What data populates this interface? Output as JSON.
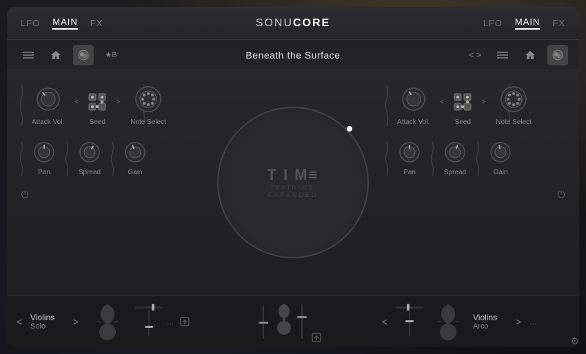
{
  "nav": {
    "left": {
      "tabs": [
        "LFO",
        "MAIN",
        "FX"
      ]
    },
    "right": {
      "tabs": [
        "LFO",
        "MAIN",
        "FX"
      ]
    },
    "logo": "SONU CORE",
    "active_tab": "MAIN"
  },
  "toolbar": {
    "title": "Beneath the Surface",
    "left_buttons": [
      "menu",
      "home",
      "layers"
    ],
    "right_buttons": [
      "menu",
      "home",
      "layers"
    ],
    "bookmark": "★B",
    "arrows": "< >"
  },
  "left_panel": {
    "row1": {
      "attack_vol": {
        "label": "Attack Vol."
      },
      "seed": {
        "label": "Seed"
      },
      "note_select": {
        "label": "Note Select"
      }
    },
    "row2": {
      "pan": {
        "label": "Pan"
      },
      "spread": {
        "label": "Spread"
      },
      "gain": {
        "label": "Gain"
      }
    },
    "instrument": {
      "name": "Violins",
      "sub": "Solo",
      "dots": "..."
    }
  },
  "right_panel": {
    "row1": {
      "attack_vol": {
        "label": "Attack Vol."
      },
      "seed": {
        "label": "Seed"
      },
      "note_select": {
        "label": "Note Select"
      }
    },
    "row2": {
      "pan": {
        "label": "Pan"
      },
      "spread": {
        "label": "Spread"
      },
      "gain": {
        "label": "Gain"
      }
    },
    "instrument": {
      "name": "Violins",
      "sub": "Arco",
      "dots": "..."
    }
  },
  "center": {
    "brand_line1": "T I M =",
    "brand_line2": "textures",
    "brand_line3": "EXPANDED"
  },
  "power": {
    "symbol": "⏻"
  },
  "gear": "⚙"
}
